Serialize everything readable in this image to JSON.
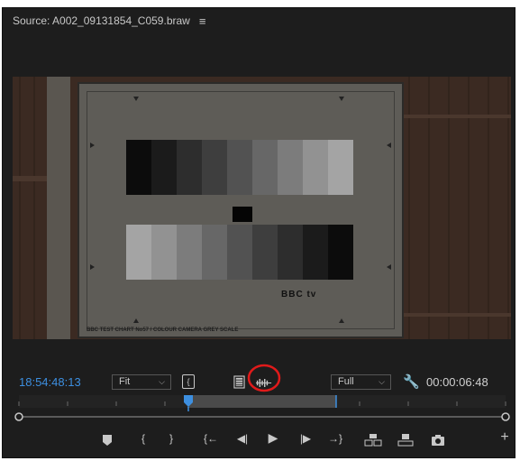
{
  "window": {
    "title": "Source: A002_09131854_C059.braw"
  },
  "chart_card": {
    "logo": "BBC tv",
    "caption": "BBC TEST CHART No57 / COLOUR CAMERA GREY SCALE"
  },
  "controls": {
    "playhead_timecode": "18:54:48:13",
    "zoom_select": "Fit",
    "resolution_select": "Full",
    "duration_timecode": "00:00:06:48"
  },
  "colors": {
    "timecode_blue": "#3d8fe0",
    "annotation_red": "#e01a1a",
    "panel_bg": "#1d1d1d"
  },
  "icons": {
    "menu": "hamburger-menu-icon",
    "insert": "insert-edit-icon",
    "drag_video": "drag-video-only-icon",
    "drag_audio": "drag-audio-only-icon",
    "settings": "wrench-icon"
  }
}
